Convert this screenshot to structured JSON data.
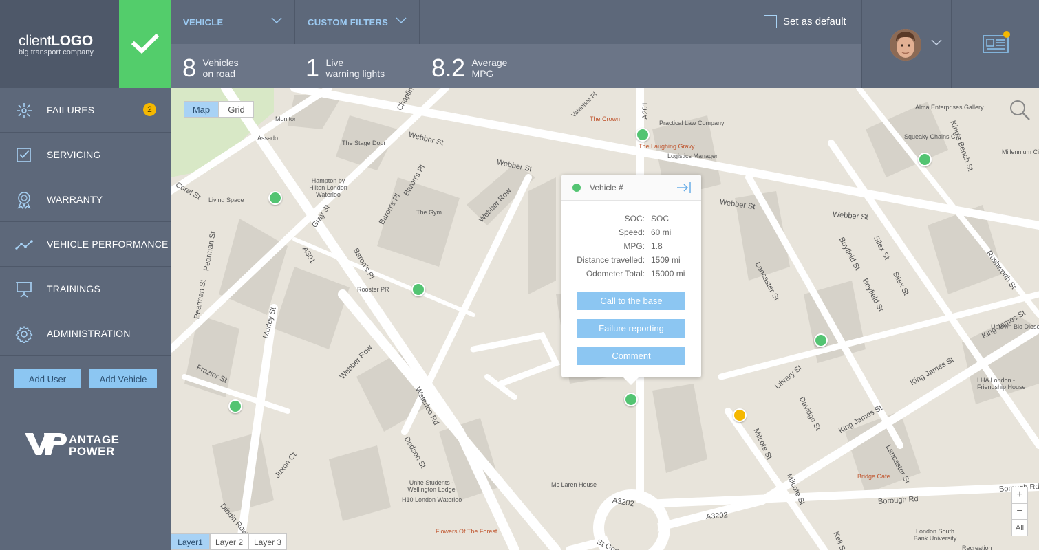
{
  "brand": {
    "logo_light": "client",
    "logo_bold": "LOGO",
    "tagline": "big transport company",
    "vp_logo_alt": "VANTAGE POWER"
  },
  "nav": [
    {
      "label": "FAILURES",
      "icon": "failures-icon",
      "badge": "2"
    },
    {
      "label": "SERVICING",
      "icon": "checkbox-icon"
    },
    {
      "label": "WARRANTY",
      "icon": "award-icon"
    },
    {
      "label": "VEHICLE PERFORMANCE",
      "icon": "trend-icon"
    },
    {
      "label": "TRAININGS",
      "icon": "presentation-icon"
    },
    {
      "label": "ADMINISTRATION",
      "icon": "gear-icon"
    }
  ],
  "actions": {
    "add_user": "Add User",
    "add_vehicle": "Add Vehicle"
  },
  "filters": {
    "vehicle": "VEHICLE",
    "custom": "CUSTOM FILTERS",
    "set_default": "Set as default"
  },
  "stats": [
    {
      "num": "8",
      "line1": "Vehicles",
      "line2": "on road"
    },
    {
      "num": "1",
      "line1": "Live",
      "line2": "warning lights"
    },
    {
      "num": "8.2",
      "line1": "Average",
      "line2": "MPG"
    }
  ],
  "map": {
    "view_toggle": {
      "map": "Map",
      "grid": "Grid",
      "active": "Map"
    },
    "layers": [
      "Layer1",
      "Layer 2",
      "Layer 3"
    ],
    "zoom": {
      "in": "+",
      "out": "−",
      "all": "All"
    },
    "places": [
      "Monitor",
      "Assado",
      "The Stage Door",
      "Hampton by Hilton London Waterloo",
      "Living Space",
      "The Gym",
      "Rooster PR",
      "The Crown",
      "Practical Law Company",
      "The Laughing Gravy",
      "Logistics Manager",
      "Alma Enterprises Gallery",
      "Squeaky Chains CIC",
      "Millennium City",
      "Uptown Bio Diesel",
      "LHA London - Friendship House",
      "Bridge Cafe",
      "Mc Laren House",
      "Unite Students - Wellington Lodge",
      "H10 London Waterloo",
      "Flowers Of The Forest",
      "London South Bank University",
      "Recreation"
    ],
    "streets": [
      "Webber St",
      "Webber St",
      "Webber St",
      "Webber St",
      "Webber Row",
      "Webber Row",
      "Coral St",
      "Gray St",
      "Baron's Pl",
      "Baron's Pl",
      "Baron's Pl",
      "A301",
      "Pearman St",
      "Pearman St",
      "Morley St",
      "Frazier St",
      "Waterloo Rd",
      "Dodson St",
      "Juxon Ct",
      "Dibdin Row",
      "A3202",
      "A3202",
      "A201",
      "Lancaster St",
      "Lancaster St",
      "Boyfield St",
      "Boyfield St",
      "Silex St",
      "Silex St",
      "Rushworth St",
      "King James St",
      "King James St",
      "King James St",
      "Library St",
      "Davidge St",
      "Milcote St",
      "Milcote St",
      "Borough Rd",
      "Borough Rd",
      "Kell St",
      "St George's",
      "Chaplin",
      "King's Bench St",
      "Valentine Pl"
    ]
  },
  "popup": {
    "title": "Vehicle #",
    "rows": [
      {
        "k": "SOC:",
        "v": "SOC"
      },
      {
        "k": "Speed:",
        "v": "60 mi"
      },
      {
        "k": "MPG:",
        "v": "1.8"
      },
      {
        "k": "Distance travelled:",
        "v": "1509 mi"
      },
      {
        "k": "Odometer Total:",
        "v": "15000 mi"
      }
    ],
    "buttons": [
      "Call to the base",
      "Failure reporting",
      "Comment"
    ]
  },
  "colors": {
    "green": "#53cd6b",
    "accent": "#8cc6f2",
    "warning": "#f5b800",
    "sidebar": "#5d687a"
  }
}
